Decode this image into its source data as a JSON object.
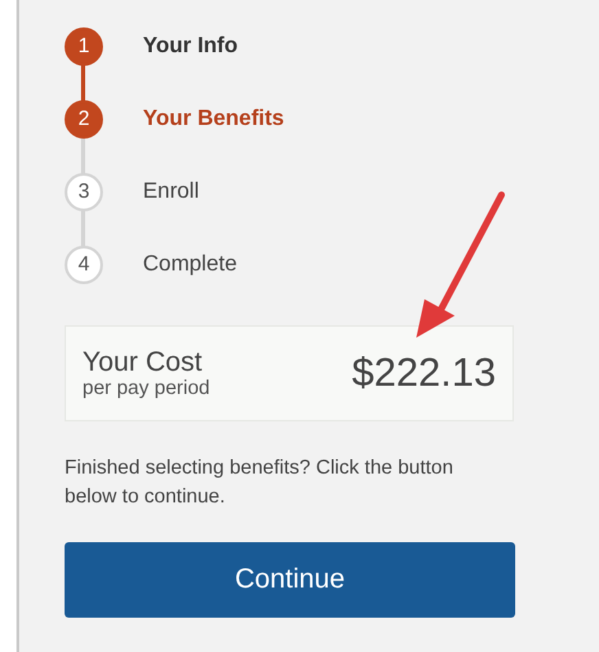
{
  "steps": [
    {
      "number": "1",
      "label": "Your Info",
      "reached": true,
      "selected": false
    },
    {
      "number": "2",
      "label": "Your Benefits",
      "reached": true,
      "selected": true
    },
    {
      "number": "3",
      "label": "Enroll",
      "reached": false,
      "selected": false
    },
    {
      "number": "4",
      "label": "Complete",
      "reached": false,
      "selected": false
    }
  ],
  "cost": {
    "title": "Your Cost",
    "subtitle": "per pay period",
    "amount": "$222.13"
  },
  "message": "Finished selecting benefits? Click the button below to continue.",
  "button": "Continue",
  "callout_arrow": true
}
